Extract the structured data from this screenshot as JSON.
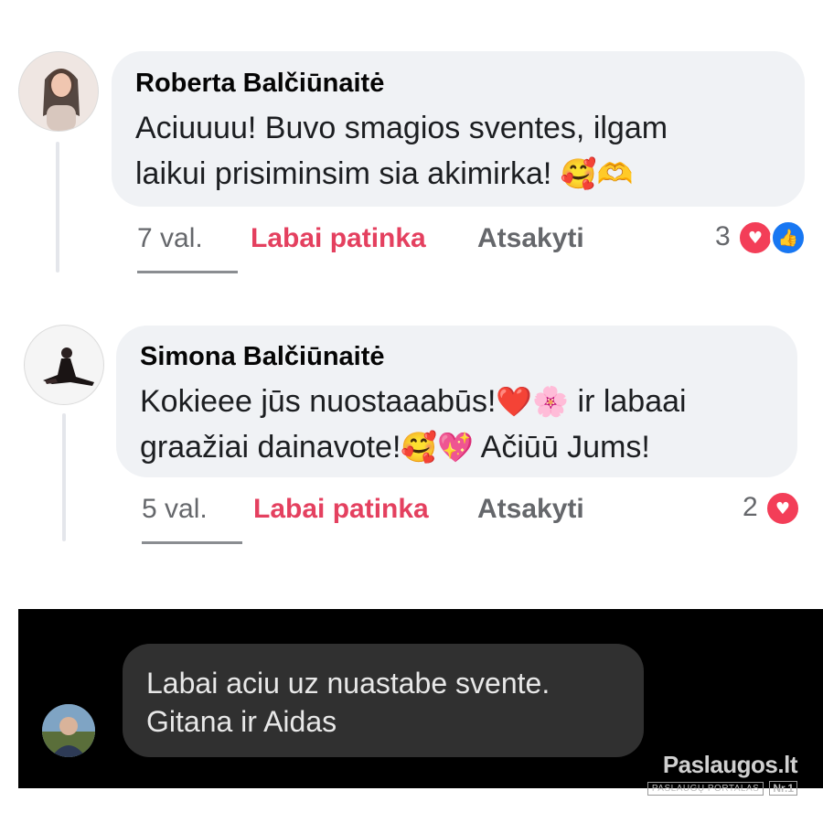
{
  "comments": [
    {
      "author": "Roberta Balčiūnaitė",
      "line1": "Aciuuuu!  Buvo smagios sventes, ilgam",
      "line2": "laikui prisiminsim sia akimirka! ",
      "line2_emoji": "🥰🫶",
      "time": "7 val.",
      "like_label": "Labai patinka",
      "reply_label": "Atsakyti",
      "reaction_count": "3",
      "reactions": [
        "heart-icon",
        "thumbs-up-icon"
      ]
    },
    {
      "author": "Simona Balčiūnaitė",
      "line1": "Kokieee jūs nuostaaabūs!",
      "line1_emoji": "❤️🌸",
      "line1_tail": " ir labaai",
      "line2": "graažiai dainavote!",
      "line2_emoji": "🥰💖",
      "line2_tail": " Ačiūū Jums!",
      "time": "5 val.",
      "like_label": "Labai patinka",
      "reply_label": "Atsakyti",
      "reaction_count": "2",
      "reactions": [
        "heart-icon"
      ]
    }
  ],
  "message": {
    "line1": "Labai aciu uz nuastabe  svente.",
    "line2": "Gitana ir Aidas"
  },
  "watermark": {
    "logo": "Paslaugos.lt",
    "tagline": "PASLAUGŲ PORTALAS",
    "badge": "Nr.1"
  }
}
